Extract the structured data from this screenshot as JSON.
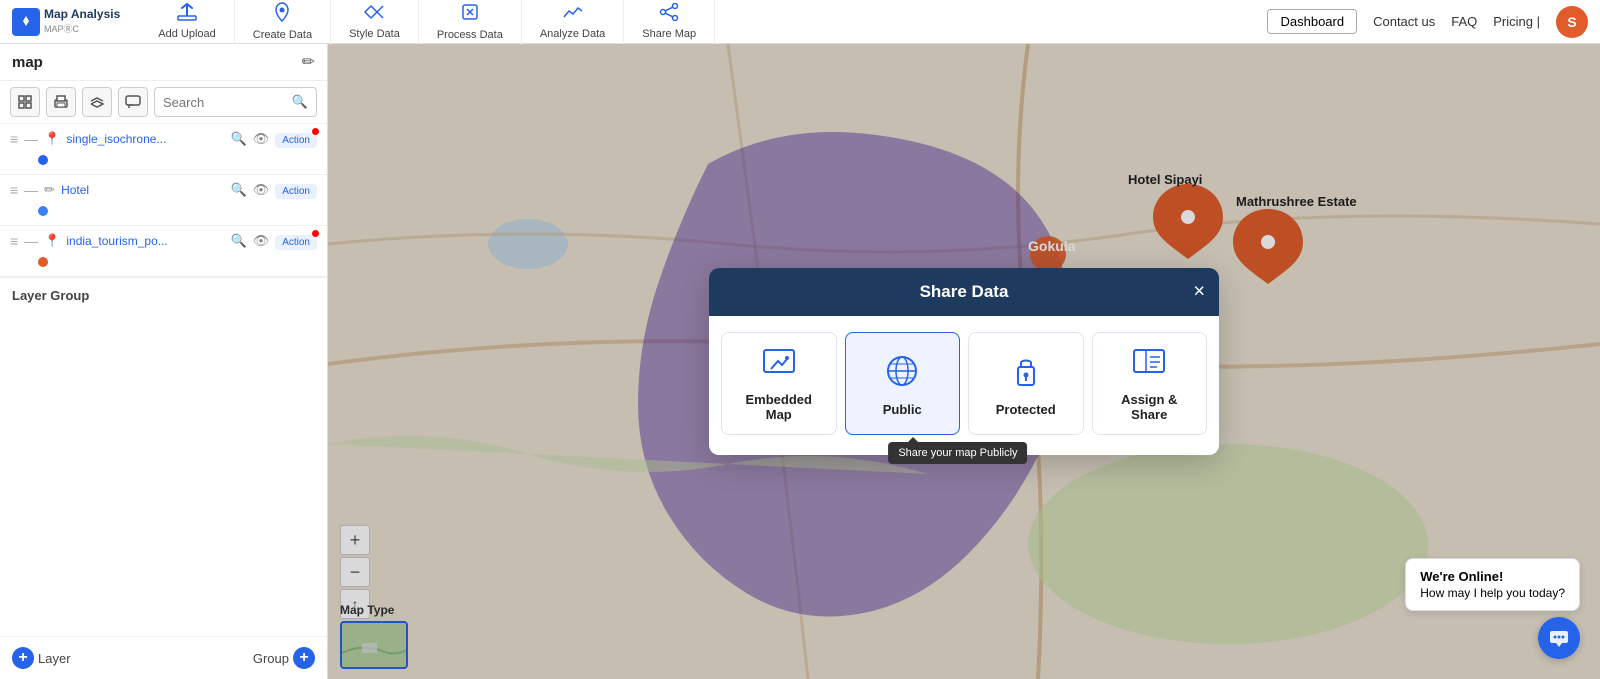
{
  "brand": {
    "logo": "M",
    "name": "Map Analysis",
    "sub": "MAPⓇC"
  },
  "topnav": {
    "items": [
      {
        "id": "add-upload",
        "label": "Add Upload",
        "icon": "☁"
      },
      {
        "id": "create-data",
        "label": "Create Data",
        "icon": "📍"
      },
      {
        "id": "style-data",
        "label": "Style Data",
        "icon": "🎨"
      },
      {
        "id": "process-data",
        "label": "Process Data",
        "icon": "⚙"
      },
      {
        "id": "analyze-data",
        "label": "Analyze Data",
        "icon": "📊"
      },
      {
        "id": "share-map",
        "label": "Share Map",
        "icon": "🔗"
      }
    ],
    "dashboard": "Dashboard",
    "contact": "Contact us",
    "faq": "FAQ",
    "pricing": "Pricing |",
    "avatar_initial": "S"
  },
  "sidebar": {
    "title": "map",
    "search_placeholder": "Search",
    "layers": [
      {
        "id": "layer1",
        "name": "single_isochronе...",
        "icon": "📍",
        "color": "#2563eb",
        "dot_color": "#2563eb",
        "has_red_dot": true
      },
      {
        "id": "layer2",
        "name": "Hotel",
        "icon": "✏",
        "color": "#3b82f6",
        "dot_color": "#3b82f6",
        "has_red_dot": false
      },
      {
        "id": "layer3",
        "name": "india_tourism_po...",
        "icon": "📍",
        "color": "#e05c2a",
        "dot_color": "#e05c2a",
        "has_red_dot": true
      }
    ],
    "layer_label": "Layer",
    "group_label": "Group"
  },
  "modal": {
    "title": "Share Data",
    "close_label": "×",
    "options": [
      {
        "id": "embedded-map",
        "label": "Embedded\nMap",
        "icon": "🗺",
        "active": false,
        "tooltip": null
      },
      {
        "id": "public",
        "label": "Public",
        "icon": "🌐",
        "active": true,
        "tooltip": "Share your map Publicly"
      },
      {
        "id": "protected",
        "label": "Protected",
        "icon": "🔒",
        "active": false,
        "tooltip": null
      },
      {
        "id": "assign-share",
        "label": "Assign &\nShare",
        "icon": "📤",
        "active": false,
        "tooltip": null
      }
    ]
  },
  "map": {
    "type_label": "Map Type",
    "zoom_in": "+",
    "zoom_out": "−",
    "reset": "↑"
  },
  "chat": {
    "title": "We're Online!",
    "subtitle": "How may I help you today?"
  }
}
